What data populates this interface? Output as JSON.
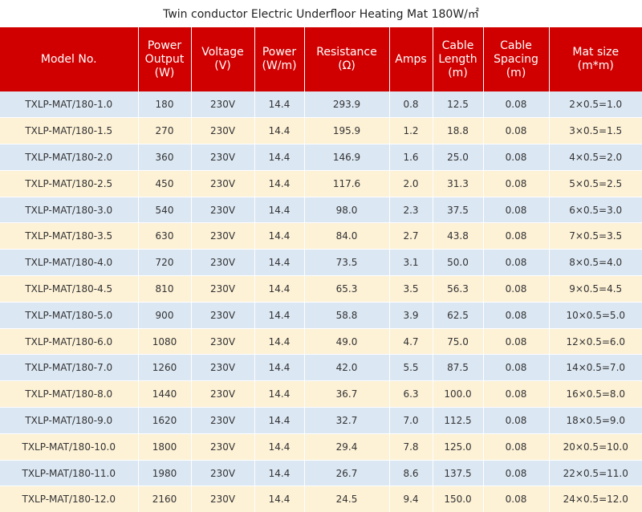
{
  "title": "Twin conductor Electric Underfloor Heating Mat 180W/㎡",
  "headers": [
    [
      "Model No."
    ],
    [
      "Power",
      "Output",
      "(W)"
    ],
    [
      "Voltage",
      "(V)"
    ],
    [
      "Power",
      "(W/m)"
    ],
    [
      "Resistance",
      "(Ω)"
    ],
    [
      "Amps"
    ],
    [
      "Cable",
      "Length",
      "(m)"
    ],
    [
      "Cable",
      "Spacing",
      "(m)"
    ],
    [
      "Mat size",
      "(m*m)"
    ]
  ],
  "rows": [
    [
      "TXLP-MAT/180-1.0",
      "180",
      "230V",
      "14.4",
      "293.9",
      "0.8",
      "12.5",
      "0.08",
      "2×0.5=1.0"
    ],
    [
      "TXLP-MAT/180-1.5",
      "270",
      "230V",
      "14.4",
      "195.9",
      "1.2",
      "18.8",
      "0.08",
      "3×0.5=1.5"
    ],
    [
      "TXLP-MAT/180-2.0",
      "360",
      "230V",
      "14.4",
      "146.9",
      "1.6",
      "25.0",
      "0.08",
      "4×0.5=2.0"
    ],
    [
      "TXLP-MAT/180-2.5",
      "450",
      "230V",
      "14.4",
      "117.6",
      "2.0",
      "31.3",
      "0.08",
      "5×0.5=2.5"
    ],
    [
      "TXLP-MAT/180-3.0",
      "540",
      "230V",
      "14.4",
      "98.0",
      "2.3",
      "37.5",
      "0.08",
      "6×0.5=3.0"
    ],
    [
      "TXLP-MAT/180-3.5",
      "630",
      "230V",
      "14.4",
      "84.0",
      "2.7",
      "43.8",
      "0.08",
      "7×0.5=3.5"
    ],
    [
      "TXLP-MAT/180-4.0",
      "720",
      "230V",
      "14.4",
      "73.5",
      "3.1",
      "50.0",
      "0.08",
      "8×0.5=4.0"
    ],
    [
      "TXLP-MAT/180-4.5",
      "810",
      "230V",
      "14.4",
      "65.3",
      "3.5",
      "56.3",
      "0.08",
      "9×0.5=4.5"
    ],
    [
      "TXLP-MAT/180-5.0",
      "900",
      "230V",
      "14.4",
      "58.8",
      "3.9",
      "62.5",
      "0.08",
      "10×0.5=5.0"
    ],
    [
      "TXLP-MAT/180-6.0",
      "1080",
      "230V",
      "14.4",
      "49.0",
      "4.7",
      "75.0",
      "0.08",
      "12×0.5=6.0"
    ],
    [
      "TXLP-MAT/180-7.0",
      "1260",
      "230V",
      "14.4",
      "42.0",
      "5.5",
      "87.5",
      "0.08",
      "14×0.5=7.0"
    ],
    [
      "TXLP-MAT/180-8.0",
      "1440",
      "230V",
      "14.4",
      "36.7",
      "6.3",
      "100.0",
      "0.08",
      "16×0.5=8.0"
    ],
    [
      "TXLP-MAT/180-9.0",
      "1620",
      "230V",
      "14.4",
      "32.7",
      "7.0",
      "112.5",
      "0.08",
      "18×0.5=9.0"
    ],
    [
      "TXLP-MAT/180-10.0",
      "1800",
      "230V",
      "14.4",
      "29.4",
      "7.8",
      "125.0",
      "0.08",
      "20×0.5=10.0"
    ],
    [
      "TXLP-MAT/180-11.0",
      "1980",
      "230V",
      "14.4",
      "26.7",
      "8.6",
      "137.5",
      "0.08",
      "22×0.5=11.0"
    ],
    [
      "TXLP-MAT/180-12.0",
      "2160",
      "230V",
      "14.4",
      "24.5",
      "9.4",
      "150.0",
      "0.08",
      "24×0.5=12.0"
    ]
  ],
  "colors": {
    "header_bg": "#d00000",
    "row_odd": "#dbe7f3",
    "row_even": "#fdf1d6"
  }
}
